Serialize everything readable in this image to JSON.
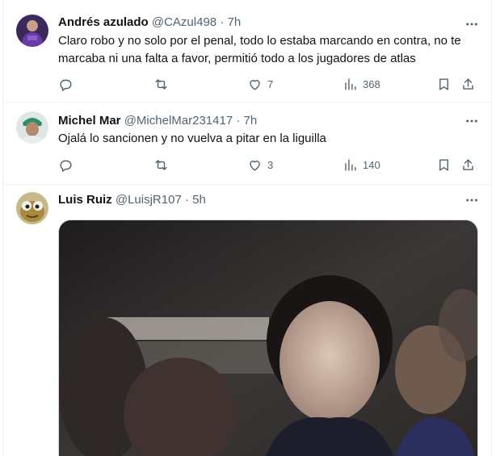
{
  "tweets": [
    {
      "name": "Andrés azulado",
      "handle": "@CAzul498",
      "separator": "·",
      "time": "7h",
      "text": "Claro robo y no solo por el penal, todo lo estaba marcando en contra, no te marcaba ni una falta a favor, permitió todo a los jugadores de atlas",
      "likes": "7",
      "views": "368"
    },
    {
      "name": "Michel Mar",
      "handle": "@MichelMar231417",
      "separator": "·",
      "time": "7h",
      "text": "Ojalá lo sancionen y no vuelva a pitar en la liguilla",
      "likes": "3",
      "views": "140"
    },
    {
      "name": "Luis Ruiz",
      "handle": "@LuisjR107",
      "separator": "·",
      "time": "5h"
    }
  ],
  "icons": {
    "reply": "reply-icon",
    "retweet": "retweet-icon",
    "like": "heart-icon",
    "views": "views-icon",
    "bookmark": "bookmark-icon",
    "share": "share-icon",
    "more": "more-icon"
  },
  "colors": {
    "text": "#0f1419",
    "secondary": "#536471",
    "border": "#eff3f4"
  }
}
